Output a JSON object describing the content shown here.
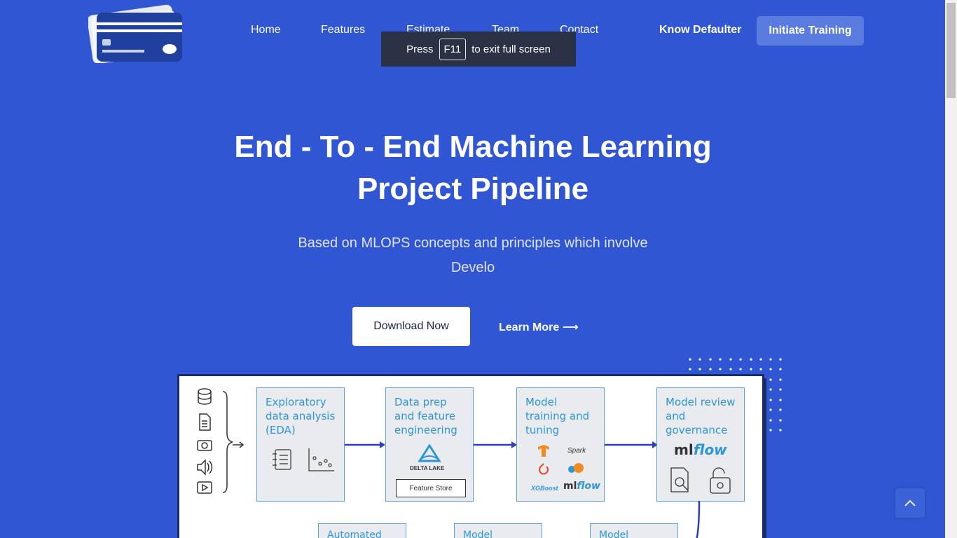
{
  "header": {
    "nav": [
      "Home",
      "Features",
      "Estimate",
      "Team",
      "Contact"
    ],
    "know_defaulter": "Know Defaulter",
    "cta": "Initiate Training"
  },
  "toast": {
    "press": "Press",
    "key": "F11",
    "rest": "to exit full screen"
  },
  "hero": {
    "title_line1": "End - To - End Machine Learning",
    "title_line2": "Project Pipeline",
    "subtitle_line1": "Based on MLOPS concepts and principles which involve",
    "subtitle_line2": "Develo",
    "download_label": "Download Now",
    "learn_label": "Learn More ⟶"
  },
  "diagram": {
    "stages": [
      {
        "title": "Exploratory data analysis (EDA)"
      },
      {
        "title": "Data prep and feature engineering"
      },
      {
        "title": "Model training and tuning"
      },
      {
        "title": "Model review and governance"
      }
    ],
    "feature_store": "Feature Store",
    "delta_lake": "DELTA LAKE",
    "spark": "Spark",
    "xgboost": "XGBoost",
    "mlflow_ml": "ml",
    "mlflow_flow": "flow",
    "row2": [
      "Automated",
      "Model",
      "Model"
    ]
  },
  "colors": {
    "background": "#3056d3",
    "accent_text": "#2d96d8"
  }
}
